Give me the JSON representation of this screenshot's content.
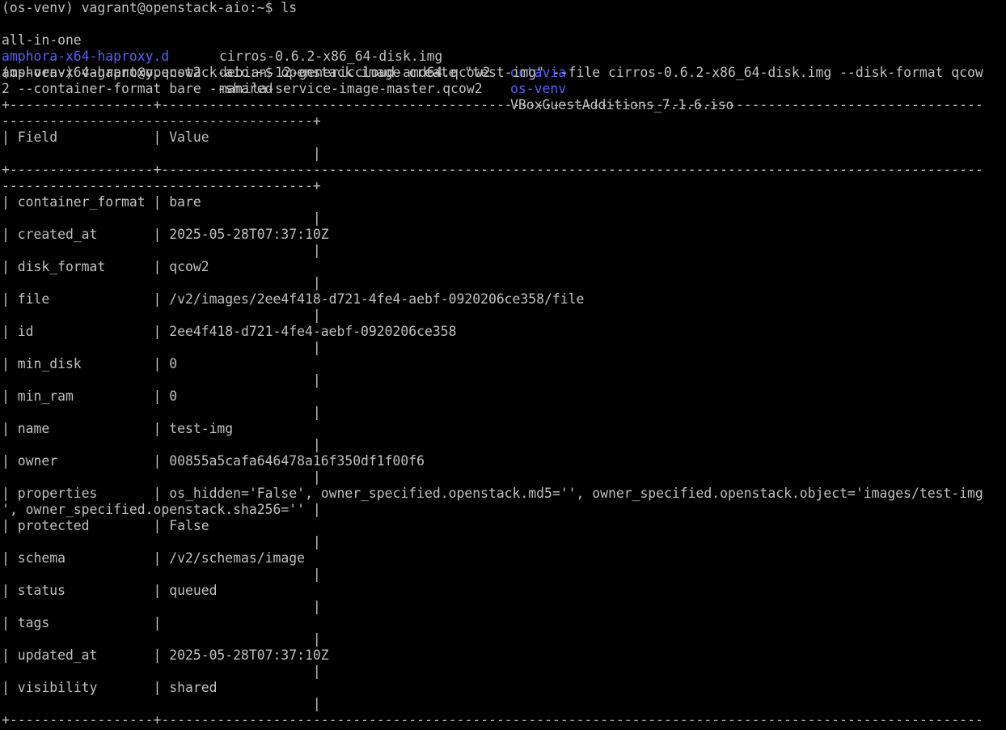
{
  "colors": {
    "background": "#000000",
    "text": "#c0c0c0",
    "directory": "#5c5cff"
  },
  "lines": {
    "l01": "(os-venv) vagrant@openstack-aio:~$ ls",
    "l02a": "all-in-one",
    "l02b": "cirros-0.6.2-x86_64-disk.img",
    "l02c": "octavia",
    "l03a": "amphora-x64-haproxy.d",
    "l03b": "debian-12-genericcloud-amd64.qcow2",
    "l03c": "os-venv",
    "l04a": "amphora-x64-haproxy.qcow2",
    "l04b": "manila-service-image-master.qcow2",
    "l04c": "VBoxGuestAdditions_7.1.6.iso",
    "l05": "(os-venv) vagrant@openstack-aio:~$ openstack image create \"test-img\" --file cirros-0.6.2-x86_64-disk.img --disk-format qcow",
    "l06": "2 --container-format bare --shared",
    "l07": "+------------------+-------------------------------------------------------------------------------------------------------",
    "l08": "---------------------------------------+",
    "l09": "| Field            | Value",
    "l10": "                                       |",
    "l11": "+------------------+-------------------------------------------------------------------------------------------------------",
    "l12": "---------------------------------------+",
    "l13": "| container_format | bare",
    "l14": "                                       |",
    "l15": "| created_at       | 2025-05-28T07:37:10Z",
    "l16": "                                       |",
    "l17": "| disk_format      | qcow2",
    "l18": "                                       |",
    "l19": "| file             | /v2/images/2ee4f418-d721-4fe4-aebf-0920206ce358/file",
    "l20": "                                       |",
    "l21": "| id               | 2ee4f418-d721-4fe4-aebf-0920206ce358",
    "l22": "                                       |",
    "l23": "| min_disk         | 0",
    "l24": "                                       |",
    "l25": "| min_ram          | 0",
    "l26": "                                       |",
    "l27": "| name             | test-img",
    "l28": "                                       |",
    "l29": "| owner            | 00855a5cafa646478a16f350df1f00f6",
    "l30": "                                       |",
    "l31": "| properties       | os_hidden='False', owner_specified.openstack.md5='', owner_specified.openstack.object='images/test-img",
    "l32": "', owner_specified.openstack.sha256='' |",
    "l33": "| protected        | False",
    "l34": "                                       |",
    "l35": "| schema           | /v2/schemas/image",
    "l36": "                                       |",
    "l37": "| status           | queued",
    "l38": "                                       |",
    "l39": "| tags             |",
    "l40": "                                       |",
    "l41": "| updated_at       | 2025-05-28T07:37:10Z",
    "l42": "                                       |",
    "l43": "| visibility       | shared",
    "l44": "                                       |",
    "l45": "+------------------+-------------------------------------------------------------------------------------------------------"
  }
}
